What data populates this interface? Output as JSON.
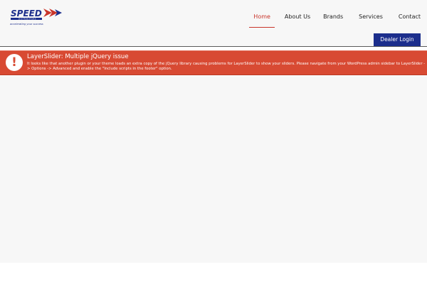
{
  "brand": {
    "logo_text": "SPEED",
    "logo_subtext": "DISTRIBUTORS",
    "tagline": "accelerating your success",
    "colors": {
      "primary": "#1c2e8c",
      "accent": "#c8342a"
    }
  },
  "nav": {
    "items": [
      {
        "label": "Home",
        "active": true
      },
      {
        "label": "About Us",
        "active": false
      },
      {
        "label": "Brands",
        "active": false
      },
      {
        "label": "Services",
        "active": false
      },
      {
        "label": "Contact",
        "active": false
      }
    ],
    "active_color": "#c8342a"
  },
  "dealer_login": {
    "label": "Dealer Login",
    "color": "#1c2e8c"
  },
  "alert": {
    "icon": "exclamation-icon",
    "title": "LayerSlider: Multiple jQuery issue",
    "body": "It looks like that another plugin or your theme loads an extra copy of the jQuery library causing problems for LayerSlider to show your sliders. Please navigate from your WordPress admin sidebar to LayerSlider -> Options -> Advanced and enable the \"Include scripts in the footer\" option.",
    "color": "#d84a33"
  }
}
